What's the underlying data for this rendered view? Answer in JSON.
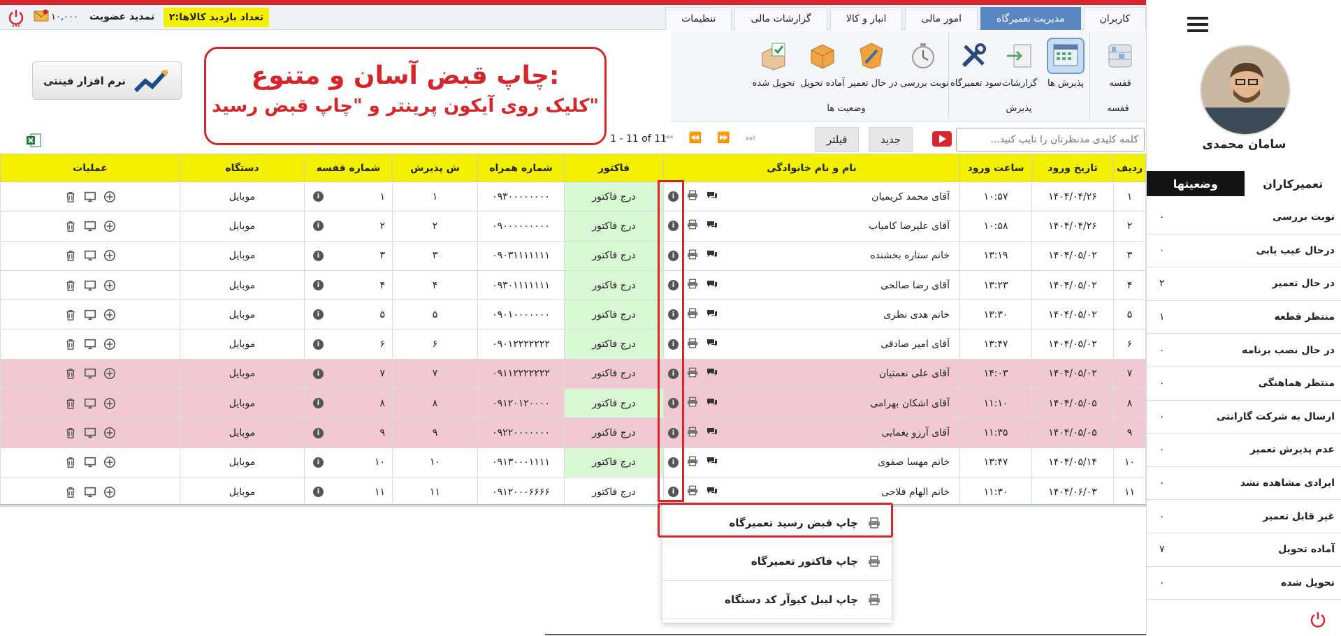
{
  "menubar": {
    "tabs": [
      "کاربران",
      "مدیریت تعمیرگاه",
      "امور مالی",
      "انبار و کالا",
      "گزارشات مالی",
      "تنظیمات"
    ],
    "active_tab": "مدیریت تعمیرگاه",
    "visit_badge": "تعداد بازدید کالاها:۲",
    "renew_label": "تمدید عضویت",
    "credit": "۱۰,۰۰۰"
  },
  "ribbon": {
    "items": [
      {
        "label": "قفسه",
        "icon": "shelf-icon"
      },
      {
        "label": "پذیرش ها",
        "icon": "reception-icon"
      },
      {
        "label": "گزارشات",
        "icon": "report-icon"
      },
      {
        "label": "سود تعمیرگاه",
        "icon": "tools-icon"
      },
      {
        "label": "نوبت بررسی",
        "icon": "timer-icon"
      },
      {
        "label": "در حال تعمیر",
        "icon": "repair-icon"
      },
      {
        "label": "آماده تحویل",
        "icon": "package-icon"
      },
      {
        "label": "تحویل شده",
        "icon": "delivered-icon"
      }
    ],
    "groups": [
      "قفسه",
      "پذیرش",
      "وضعیت ها"
    ]
  },
  "promo": {
    "line1": "چاپ قبض آسان و متنوع:",
    "line2": "کلیک روی آیکون پرینتر و \"چاپ قبض رسید\""
  },
  "logo": {
    "text": "نرم افزار فینتی"
  },
  "toolbar": {
    "search_placeholder": "کلمه کلیدی مدنظرتان را تایپ کنید...",
    "new_label": "جدید",
    "filter_label": "فیلتر",
    "pager": "1 - 11 of 11"
  },
  "table": {
    "headers": [
      "ردیف",
      "تاریخ ورود",
      "ساعت ورود",
      "نام و نام خانوادگی",
      "فاکتور",
      "شماره همراه",
      "ش پذیرش",
      "شماره قفسه",
      "دستگاه",
      "عملیات"
    ],
    "rows": [
      {
        "n": "۱",
        "date": "۱۴۰۴/۰۴/۲۶",
        "time": "۱۰:۵۷",
        "name": "آقای محمد کریمیان",
        "invoice": "درج فاکتور",
        "phone": "۰۹۳۰۰۰۰۰۰۰۰",
        "rec": "۱",
        "shelf": "۱",
        "device": "موبایل",
        "pink": false,
        "green": true
      },
      {
        "n": "۲",
        "date": "۱۴۰۴/۰۴/۲۶",
        "time": "۱۰:۵۸",
        "name": "آقای علیرضا کامیاب",
        "invoice": "درج فاکتور",
        "phone": "۰۹۰۰۰۰۰۰۰۰۰",
        "rec": "۲",
        "shelf": "۲",
        "device": "موبایل",
        "pink": false,
        "green": true
      },
      {
        "n": "۳",
        "date": "۱۴۰۴/۰۵/۰۲",
        "time": "۱۳:۱۹",
        "name": "خانم ستاره بخشنده",
        "invoice": "درج فاکتور",
        "phone": "۰۹۰۳۱۱۱۱۱۱۱",
        "rec": "۳",
        "shelf": "۳",
        "device": "موبایل",
        "pink": false,
        "green": true
      },
      {
        "n": "۴",
        "date": "۱۴۰۴/۰۵/۰۲",
        "time": "۱۳:۲۳",
        "name": "آقای رضا صالحی",
        "invoice": "درج فاکتور",
        "phone": "۰۹۳۰۱۱۱۱۱۱۱",
        "rec": "۴",
        "shelf": "۴",
        "device": "موبایل",
        "pink": false,
        "green": true
      },
      {
        "n": "۵",
        "date": "۱۴۰۴/۰۵/۰۲",
        "time": "۱۳:۳۰",
        "name": "خانم هدی نظری",
        "invoice": "درج فاکتور",
        "phone": "۰۹۰۱۰۰۰۰۰۰۰",
        "rec": "۵",
        "shelf": "۵",
        "device": "موبایل",
        "pink": false,
        "green": true
      },
      {
        "n": "۶",
        "date": "۱۴۰۴/۰۵/۰۲",
        "time": "۱۳:۴۷",
        "name": "آقای امیر صادقی",
        "invoice": "درج فاکتور",
        "phone": "۰۹۰۱۲۲۲۲۲۲۲",
        "rec": "۶",
        "shelf": "۶",
        "device": "موبایل",
        "pink": false,
        "green": true
      },
      {
        "n": "۷",
        "date": "۱۴۰۴/۰۵/۰۲",
        "time": "۱۴:۰۳",
        "name": "آقای علی نعمتیان",
        "invoice": "درج فاکتور",
        "phone": "۰۹۱۱۲۲۲۲۲۲۲",
        "rec": "۷",
        "shelf": "۷",
        "device": "موبایل",
        "pink": true,
        "green": false
      },
      {
        "n": "۸",
        "date": "۱۴۰۴/۰۵/۰۵",
        "time": "۱۱:۱۰",
        "name": "آقای اشکان بهرامی",
        "invoice": "درج فاکتور",
        "phone": "۰۹۱۲۰۱۲۰۰۰۰",
        "rec": "۸",
        "shelf": "۸",
        "device": "موبایل",
        "pink": true,
        "green": true
      },
      {
        "n": "۹",
        "date": "۱۴۰۴/۰۵/۰۵",
        "time": "۱۱:۳۵",
        "name": "آقای آرزو یغمایی",
        "invoice": "درج فاکتور",
        "phone": "۰۹۲۲۰۰۰۰۰۰۰",
        "rec": "۹",
        "shelf": "۹",
        "device": "موبایل",
        "pink": true,
        "green": false
      },
      {
        "n": "۱۰",
        "date": "۱۴۰۴/۰۵/۱۴",
        "time": "۱۳:۴۷",
        "name": "خانم مهسا صفوی",
        "invoice": "درج فاکتور",
        "phone": "۰۹۱۳۰۰۰۱۱۱۱",
        "rec": "۱۰",
        "shelf": "۱۰",
        "device": "موبایل",
        "pink": false,
        "green": true
      },
      {
        "n": "۱۱",
        "date": "۱۴۰۴/۰۶/۰۳",
        "time": "۱۱:۳۰",
        "name": "خانم الهام فلاحی",
        "invoice": "درج فاکتور",
        "phone": "۰۹۱۲۰۰۰۶۶۶۶",
        "rec": "۱۱",
        "shelf": "۱۱",
        "device": "موبایل",
        "pink": false,
        "green": false
      }
    ]
  },
  "dropdown": {
    "items": [
      "چاپ قبض رسید تعمیرگاه",
      "چاپ فاکتور تعمیرگاه",
      "چاپ لیبل کیوآر کد دستگاه"
    ]
  },
  "sidebar": {
    "user_name": "سامان محمدی",
    "tabs": [
      "تعمیرکاران",
      "وضعیتها"
    ],
    "statuses": [
      {
        "label": "نوبت بررسی",
        "count": "۰"
      },
      {
        "label": "درحال عیب یابی",
        "count": "۰"
      },
      {
        "label": "در حال تعمیر",
        "count": "۲"
      },
      {
        "label": "منتظر قطعه",
        "count": "۱"
      },
      {
        "label": "در حال نصب برنامه",
        "count": "۰"
      },
      {
        "label": "منتظر هماهنگی",
        "count": "۰"
      },
      {
        "label": "ارسال به شرکت گارانتی",
        "count": "۰"
      },
      {
        "label": "عدم پذیرش تعمیر",
        "count": "۰"
      },
      {
        "label": "ایرادی مشاهده نشد",
        "count": "۰"
      },
      {
        "label": "غیر قابل تعمیر",
        "count": "۰"
      },
      {
        "label": "آماده تحویل",
        "count": "۷"
      },
      {
        "label": "تحویل شده",
        "count": "۰"
      }
    ]
  },
  "colors": {
    "accent": "#5b86c4",
    "highlight": "#d7262b",
    "header_yellow": "#f4f100",
    "pink_row": "#f1c9d2",
    "green_cell": "#d8f8d4"
  }
}
